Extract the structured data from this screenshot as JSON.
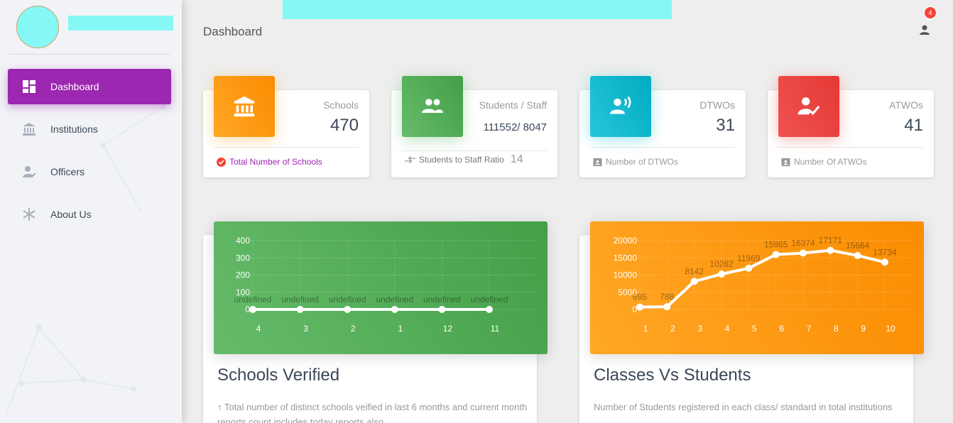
{
  "header": {
    "title": "Dashboard",
    "notification_count": "4"
  },
  "sidebar": {
    "items": [
      {
        "label": "Dashboard",
        "icon": "dashboard-icon",
        "active": true
      },
      {
        "label": "Institutions",
        "icon": "institution-icon",
        "active": false
      },
      {
        "label": "Officers",
        "icon": "officer-icon",
        "active": false
      },
      {
        "label": "About Us",
        "icon": "snowflake-icon",
        "active": false
      }
    ]
  },
  "stats": [
    {
      "category": "Schools",
      "value": "470",
      "footer": "Total Number of Schools",
      "color": "#ff9800",
      "icon": "bank-icon"
    },
    {
      "category": "Students / Staff",
      "value": "111552/ 8047",
      "footer": "Students to Staff Ratio",
      "footer_value": "14",
      "color": "#4caf50",
      "icon": "group-icon"
    },
    {
      "category": "DTWOs",
      "value": "31",
      "footer": "Number of DTWOs",
      "color": "#00bcd4",
      "icon": "record-voice-icon"
    },
    {
      "category": "ATWOs",
      "value": "41",
      "footer": "Number Of ATWOs",
      "color": "#f44336",
      "icon": "how-to-reg-icon"
    }
  ],
  "charts": {
    "schools_verified": {
      "title": "Schools Verified",
      "description": "Total number of distinct schools veified in last 6 months and current month reports count includes today reports also",
      "color": "#4caf50"
    },
    "classes_students": {
      "title": "Classes Vs Students",
      "description": "Number of Students registered in each class/ standard in total institutions",
      "color": "#ff9800"
    }
  },
  "chart_data": [
    {
      "type": "line",
      "categories": [
        "4",
        "3",
        "2",
        "1",
        "12",
        "11"
      ],
      "values": [
        0,
        0,
        0,
        0,
        0,
        0
      ],
      "point_labels": [
        "undefined",
        "undefined",
        "undefined",
        "undefined",
        "undefined",
        "undefined"
      ],
      "yticks": [
        "400",
        "300",
        "200",
        "100",
        "0"
      ],
      "ylim": [
        0,
        400
      ],
      "grid": true
    },
    {
      "type": "line",
      "categories": [
        "1",
        "2",
        "3",
        "4",
        "5",
        "6",
        "7",
        "8",
        "9",
        "10"
      ],
      "values": [
        695,
        788,
        8142,
        10282,
        11969,
        15965,
        16374,
        17171,
        15664,
        13734
      ],
      "point_labels": [
        "695",
        "788",
        "8142",
        "10282",
        "11969",
        "15965",
        "16374",
        "17171",
        "15664",
        "13734"
      ],
      "yticks": [
        "20000",
        "15000",
        "10000",
        "5000",
        "0"
      ],
      "ylim": [
        0,
        20000
      ],
      "grid": true
    }
  ]
}
